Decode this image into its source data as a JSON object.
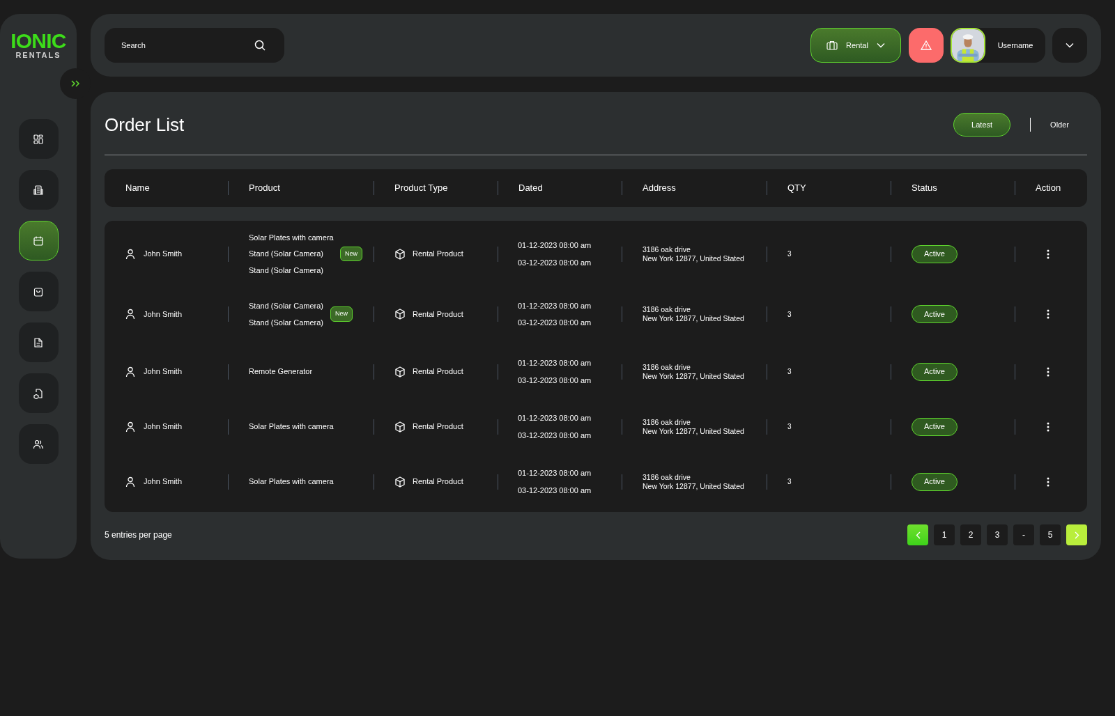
{
  "logo": {
    "top": "IONIC",
    "bottom": "RENTALS"
  },
  "sidebar": {
    "items": [
      {
        "selected": false
      },
      {
        "selected": false
      },
      {
        "selected": true
      },
      {
        "selected": false
      },
      {
        "selected": false
      },
      {
        "selected": false
      },
      {
        "selected": false
      }
    ]
  },
  "search": {
    "placeholder": "Search"
  },
  "header": {
    "mode": "Rental",
    "username": "Username"
  },
  "page": {
    "title": "Order List",
    "tabs": [
      {
        "label": "Latest",
        "selected": true
      },
      {
        "label": "Older",
        "selected": false
      }
    ]
  },
  "table": {
    "columns": [
      "Name",
      "Product",
      "Product Type",
      "Dated",
      "Address",
      "QTY",
      "Status",
      "Action"
    ],
    "rows": [
      {
        "name": "John Smith",
        "products": [
          "Solar Plates with camera",
          "Stand (Solar Camera)",
          "Stand (Solar Camera)"
        ],
        "badge": "New",
        "type": "Rental Product",
        "dates": [
          "01-12-2023 08:00 am",
          "03-12-2023 08:00 am"
        ],
        "address": [
          "3186 oak drive",
          "New York 12877, United Stated"
        ],
        "qty": "3",
        "status": "Active"
      },
      {
        "name": "John Smith",
        "products": [
          "Stand (Solar Camera)",
          "Stand (Solar Camera)"
        ],
        "badge": "New",
        "type": "Rental Product",
        "dates": [
          "01-12-2023 08:00 am",
          "03-12-2023 08:00 am"
        ],
        "address": [
          "3186 oak drive",
          "New York 12877, United Stated"
        ],
        "qty": "3",
        "status": "Active"
      },
      {
        "name": "John Smith",
        "products": [
          "Remote Generator"
        ],
        "type": "Rental Product",
        "dates": [
          "01-12-2023 08:00 am",
          "03-12-2023 08:00 am"
        ],
        "address": [
          "3186 oak drive",
          "New York 12877, United Stated"
        ],
        "qty": "3",
        "status": "Active"
      },
      {
        "name": "John Smith",
        "products": [
          "Solar Plates with camera"
        ],
        "type": "Rental Product",
        "dates": [
          "01-12-2023 08:00 am",
          "03-12-2023 08:00 am"
        ],
        "address": [
          "3186 oak drive",
          "New York 12877, United Stated"
        ],
        "qty": "3",
        "status": "Active"
      },
      {
        "name": "John Smith",
        "products": [
          "Solar Plates with camera"
        ],
        "type": "Rental Product",
        "dates": [
          "01-12-2023 08:00 am",
          "03-12-2023 08:00 am"
        ],
        "address": [
          "3186 oak drive",
          "New York 12877, United Stated"
        ],
        "qty": "3",
        "status": "Active"
      }
    ]
  },
  "footer": {
    "entries": "5 entries per page",
    "pages": [
      {
        "label": "1",
        "selected": false
      },
      {
        "label": "2",
        "selected": false
      },
      {
        "label": "3",
        "selected": false
      },
      {
        "label": "-",
        "selected": false
      },
      {
        "label": "5",
        "selected": false
      }
    ]
  }
}
